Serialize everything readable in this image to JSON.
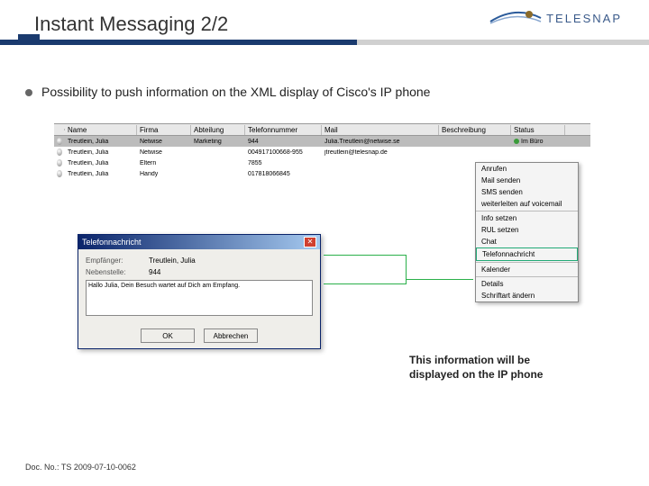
{
  "header": {
    "title": "Instant Messaging 2/2",
    "logo_text": "TELESNAP"
  },
  "bullet": {
    "text": "Possibility to push information on the XML display of Cisco's IP phone"
  },
  "table": {
    "columns": [
      "Name",
      "Firma",
      "Abteilung",
      "Telefonnummer",
      "Mail",
      "Beschreibung",
      "Status"
    ],
    "rows": [
      {
        "name": "Treutlein, Julia",
        "firma": "Netwise",
        "abt": "Marketing",
        "tel": "944",
        "mail": "Julia.Treutlein@netwise.se",
        "besch": "",
        "status": "Im Büro"
      },
      {
        "name": "Treutlein, Julia",
        "firma": "Netwise",
        "abt": "",
        "tel": "004917100668-955",
        "mail": "jtreutlein@telesnap.de",
        "besch": "",
        "status": ""
      },
      {
        "name": "Treutlein, Julia",
        "firma": "Eltern",
        "abt": "",
        "tel": "7855",
        "mail": "",
        "besch": "",
        "status": ""
      },
      {
        "name": "Treutlein, Julia",
        "firma": "Handy",
        "abt": "",
        "tel": "017818066845",
        "mail": "",
        "besch": "",
        "status": ""
      }
    ]
  },
  "context_menu": {
    "groups": [
      [
        "Anrufen",
        "Mail senden",
        "SMS senden",
        "weiterleiten auf voicemail"
      ],
      [
        "Info setzen",
        "RUL setzen",
        "Chat",
        "Telefonnachricht"
      ],
      [
        "Kalender"
      ],
      [
        "Details",
        "Schriftart ändern"
      ]
    ],
    "highlighted": "Telefonnachricht"
  },
  "dialog": {
    "title": "Telefonnachricht",
    "close": "✕",
    "recipient_label": "Empfänger:",
    "recipient_value": "Treutlein, Julia",
    "ext_label": "Nebenstelle:",
    "ext_value": "944",
    "message": "Hallo Julia, Dein Besuch wartet auf Dich am Empfang.",
    "ok": "OK",
    "cancel": "Abbrechen"
  },
  "caption": {
    "line1": "This information will be",
    "line2": "displayed on the IP phone"
  },
  "footer": {
    "text": "Doc. No.: TS 2009-07-10-0062"
  }
}
